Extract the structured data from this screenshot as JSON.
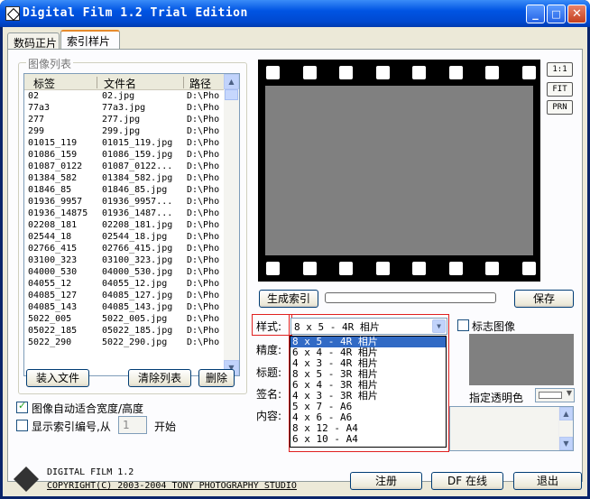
{
  "window": {
    "title": "Digital Film 1.2 Trial Edition",
    "min": "_",
    "max": "□",
    "close": "✕"
  },
  "tabs": [
    "数码正片",
    "索引样片"
  ],
  "image_list": {
    "group_title": "图像列表",
    "columns": [
      "标签",
      "文件名",
      "路径"
    ],
    "rows": [
      [
        "02",
        "02.jpg",
        "D:\\Pho"
      ],
      [
        "77a3",
        "77a3.jpg",
        "D:\\Pho"
      ],
      [
        "277",
        "277.jpg",
        "D:\\Pho"
      ],
      [
        "299",
        "299.jpg",
        "D:\\Pho"
      ],
      [
        "01015_119",
        "01015_119.jpg",
        "D:\\Pho"
      ],
      [
        "01086_159",
        "01086_159.jpg",
        "D:\\Pho"
      ],
      [
        "01087_0122",
        "01087_0122...",
        "D:\\Pho"
      ],
      [
        "01384_582",
        "01384_582.jpg",
        "D:\\Pho"
      ],
      [
        "01846_85",
        "01846_85.jpg",
        "D:\\Pho"
      ],
      [
        "01936_9957",
        "01936_9957...",
        "D:\\Pho"
      ],
      [
        "01936_14875",
        "01936_1487...",
        "D:\\Pho"
      ],
      [
        "02208_181",
        "02208_181.jpg",
        "D:\\Pho"
      ],
      [
        "02544_18",
        "02544_18.jpg",
        "D:\\Pho"
      ],
      [
        "02766_415",
        "02766_415.jpg",
        "D:\\Pho"
      ],
      [
        "03100_323",
        "03100_323.jpg",
        "D:\\Pho"
      ],
      [
        "04000_530",
        "04000_530.jpg",
        "D:\\Pho"
      ],
      [
        "04055_12",
        "04055_12.jpg",
        "D:\\Pho"
      ],
      [
        "04085_127",
        "04085_127.jpg",
        "D:\\Pho"
      ],
      [
        "04085_143",
        "04085_143.jpg",
        "D:\\Pho"
      ],
      [
        "5022_005",
        "5022_005.jpg",
        "D:\\Pho"
      ],
      [
        "05022_185",
        "05022_185.jpg",
        "D:\\Pho"
      ],
      [
        "5022_290",
        "5022_290.jpg",
        "D:\\Pho"
      ]
    ],
    "load_button": "装入文件",
    "clear_button": "清除列表",
    "delete_button": "删除"
  },
  "options": {
    "autofit_label": "图像自动适合宽度/高度",
    "autofit_checked": true,
    "show_index_label": "显示索引编号,从",
    "show_index_checked": false,
    "start_value": "1",
    "start_suffix": "开始"
  },
  "preview": {
    "btn_1to1": "1:1",
    "btn_fit": "FIT",
    "btn_prn": "PRN"
  },
  "actions": {
    "generate": "生成索引",
    "save": "保存",
    "progress": 0
  },
  "settings": {
    "style_label": "样式:",
    "style_value": "8 x 5 - 4R 相片",
    "style_options": [
      "8 x 5 - 4R 相片",
      "6 x 4 - 4R 相片",
      "4 x 3 - 4R 相片",
      "8 x 5 - 3R 相片",
      "6 x 4 - 3R 相片",
      "4 x 3 - 3R 相片",
      "5 x 7 - A6",
      "4 x 6 - A6",
      "8 x 12 - A4",
      "6 x 10 - A4"
    ],
    "precision_label": "精度:",
    "title_label": "标题:",
    "signature_label": "签名:",
    "content_label": "内容:",
    "logo_label": "标志图像",
    "logo_checked": false,
    "transparent_label": "指定透明色"
  },
  "footer": {
    "app_name": "DIGITAL FILM 1.2",
    "copyright": "COPYRIGHT(C) 2003-2004 TONY PHOTOGRAPHY STUDIO",
    "register": "注册",
    "online": "DF 在线",
    "exit": "退出"
  },
  "colors": {
    "titlebar": "#0054e3",
    "dialog": "#ece9d8",
    "highlight": "#316ac5",
    "red_box": "#e02020"
  }
}
